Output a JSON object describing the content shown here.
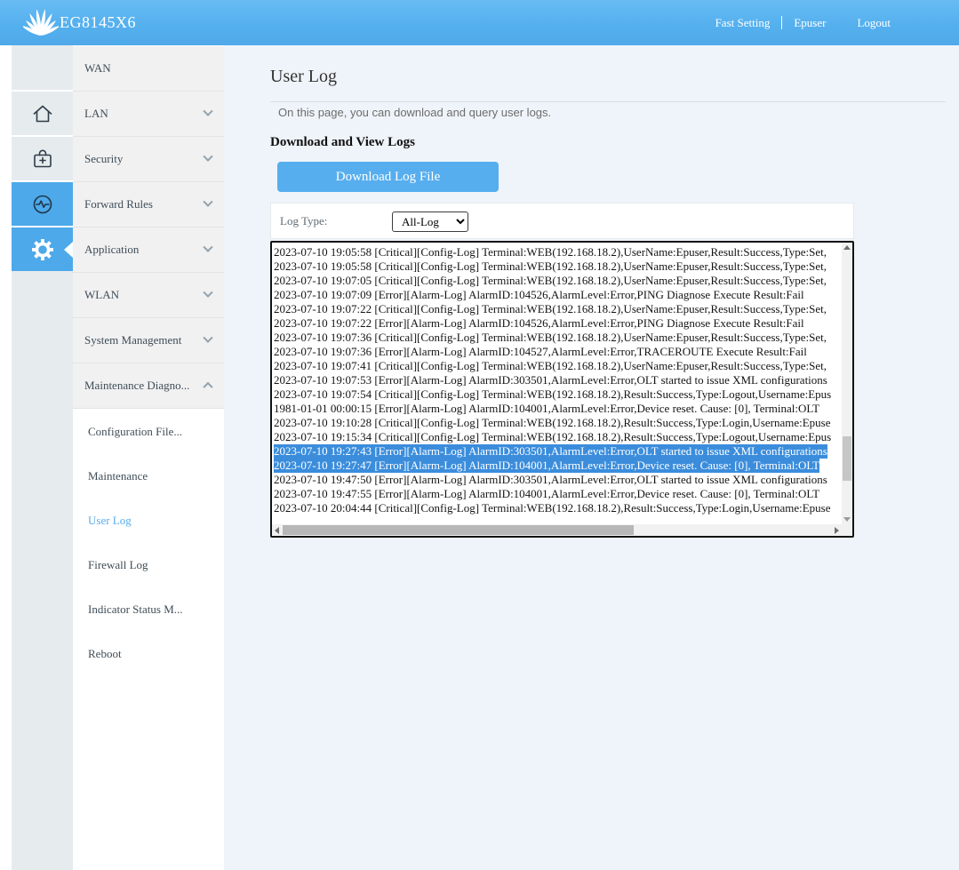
{
  "header": {
    "device_model": "EG8145X6",
    "fast_setting": "Fast Setting",
    "username": "Epuser",
    "logout": "Logout"
  },
  "sidebar": {
    "menu": [
      {
        "label": "WAN",
        "chevron": "none"
      },
      {
        "label": "LAN",
        "chevron": "down"
      },
      {
        "label": "Security",
        "chevron": "down"
      },
      {
        "label": "Forward Rules",
        "chevron": "down"
      },
      {
        "label": "Application",
        "chevron": "down"
      },
      {
        "label": "WLAN",
        "chevron": "down"
      },
      {
        "label": "System Management",
        "chevron": "down"
      },
      {
        "label": "Maintenance Diagno...",
        "chevron": "up"
      }
    ],
    "submenu": [
      {
        "label": "Configuration File...",
        "active": false
      },
      {
        "label": "Maintenance",
        "active": false
      },
      {
        "label": "User Log",
        "active": true
      },
      {
        "label": "Firewall Log",
        "active": false
      },
      {
        "label": "Indicator Status M...",
        "active": false
      },
      {
        "label": "Reboot",
        "active": false
      }
    ],
    "icons": [
      "home-icon",
      "toolbox-plus-icon",
      "diagnose-pulse-icon",
      "gear-icon"
    ]
  },
  "main": {
    "title": "User Log",
    "description": "On this page, you can download and query user logs.",
    "section_title": "Download and View Logs",
    "download_button": "Download Log File",
    "log_type_label": "Log Type:",
    "log_type_selected": "All-Log",
    "log_lines": [
      {
        "text": "2023-07-10 19:05:58 [Critical][Config-Log] Terminal:WEB(192.168.18.2),UserName:Epuser,Result:Success,Type:Set,",
        "selected": false
      },
      {
        "text": "2023-07-10 19:05:58 [Critical][Config-Log] Terminal:WEB(192.168.18.2),UserName:Epuser,Result:Success,Type:Set,",
        "selected": false
      },
      {
        "text": "2023-07-10 19:07:05 [Critical][Config-Log] Terminal:WEB(192.168.18.2),UserName:Epuser,Result:Success,Type:Set,",
        "selected": false
      },
      {
        "text": "2023-07-10 19:07:09 [Error][Alarm-Log] AlarmID:104526,AlarmLevel:Error,PING Diagnose Execute Result:Fail",
        "selected": false
      },
      {
        "text": "2023-07-10 19:07:22 [Critical][Config-Log] Terminal:WEB(192.168.18.2),UserName:Epuser,Result:Success,Type:Set,",
        "selected": false
      },
      {
        "text": "2023-07-10 19:07:22 [Error][Alarm-Log] AlarmID:104526,AlarmLevel:Error,PING Diagnose Execute Result:Fail",
        "selected": false
      },
      {
        "text": "2023-07-10 19:07:36 [Critical][Config-Log] Terminal:WEB(192.168.18.2),UserName:Epuser,Result:Success,Type:Set,",
        "selected": false
      },
      {
        "text": "2023-07-10 19:07:36 [Error][Alarm-Log] AlarmID:104527,AlarmLevel:Error,TRACEROUTE Execute Result:Fail",
        "selected": false
      },
      {
        "text": "2023-07-10 19:07:41 [Critical][Config-Log] Terminal:WEB(192.168.18.2),UserName:Epuser,Result:Success,Type:Set,",
        "selected": false
      },
      {
        "text": "2023-07-10 19:07:53 [Error][Alarm-Log] AlarmID:303501,AlarmLevel:Error,OLT started to issue XML configurations",
        "selected": false
      },
      {
        "text": "2023-07-10 19:07:54 [Critical][Config-Log] Terminal:WEB(192.168.18.2),Result:Success,Type:Logout,Username:Epus",
        "selected": false
      },
      {
        "text": "1981-01-01 00:00:15 [Error][Alarm-Log] AlarmID:104001,AlarmLevel:Error,Device reset. Cause: [0], Terminal:OLT",
        "selected": false
      },
      {
        "text": "2023-07-10 19:10:28 [Critical][Config-Log] Terminal:WEB(192.168.18.2),Result:Success,Type:Login,Username:Epuse",
        "selected": false
      },
      {
        "text": "2023-07-10 19:15:34 [Critical][Config-Log] Terminal:WEB(192.168.18.2),Result:Success,Type:Logout,Username:Epus",
        "selected": false
      },
      {
        "text": "2023-07-10 19:27:43 [Error][Alarm-Log] AlarmID:303501,AlarmLevel:Error,OLT started to issue XML configurations",
        "selected": true
      },
      {
        "text": "2023-07-10 19:27:47 [Error][Alarm-Log] AlarmID:104001,AlarmLevel:Error,Device reset. Cause: [0], Terminal:OLT",
        "selected": true
      },
      {
        "text": "2023-07-10 19:47:50 [Error][Alarm-Log] AlarmID:303501,AlarmLevel:Error,OLT started to issue XML configurations",
        "selected": false
      },
      {
        "text": "2023-07-10 19:47:55 [Error][Alarm-Log] AlarmID:104001,AlarmLevel:Error,Device reset. Cause: [0], Terminal:OLT",
        "selected": false
      },
      {
        "text": "2023-07-10 20:04:44 [Critical][Config-Log] Terminal:WEB(192.168.18.2),Result:Success,Type:Login,Username:Epuse",
        "selected": false
      }
    ]
  },
  "colors": {
    "header_blue": "#55b0ee",
    "button_blue": "#57aeee",
    "rail_active_blue": "#4da9e9",
    "selection_blue": "#3b8ddc",
    "active_link_blue": "#58acec"
  }
}
